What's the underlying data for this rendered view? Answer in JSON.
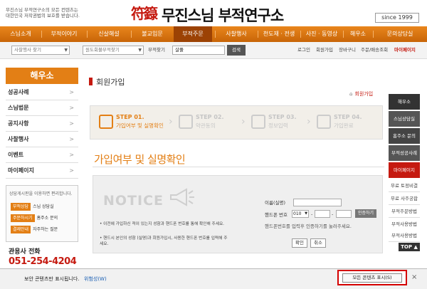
{
  "header": {
    "notice_line1": "무진스님 부적연구소의 모든 컨텐츠는",
    "notice_line2": "대한민국 저작권법의 보호를 받습니다.",
    "logo_seal": "符籙",
    "logo_text": "무진스님 부적연구소",
    "since": "since 1999"
  },
  "nav": [
    {
      "label": "스님소개"
    },
    {
      "label": "부적이야기"
    },
    {
      "label": "신살해설"
    },
    {
      "label": "불교입문"
    },
    {
      "label": "부적주문"
    },
    {
      "label": "사찰행사"
    },
    {
      "label": "천도재 · 전생"
    },
    {
      "label": "사진 · 동영상"
    },
    {
      "label": "해우소"
    },
    {
      "label": "문의상담실"
    }
  ],
  "searchbar": {
    "select1": "사찰행사 찾기",
    "select2": "원도회불부적찾기",
    "label": "부적찾기",
    "value": "살풀",
    "button": "검색",
    "links": [
      "로그인",
      "회원가입",
      "장바구니",
      "주문/배송조회"
    ],
    "mypage": "마이페이지"
  },
  "left_sidebar": {
    "title": "해우소",
    "items": [
      "성공사례",
      "스님법문",
      "공지사항",
      "사찰행사",
      "이벤트",
      "마이페이지"
    ],
    "box_caption": "상담게시판을 이용하면 편리합니다.",
    "box_rows": [
      {
        "tag": "부적상담",
        "text": "스님 상담실"
      },
      {
        "tag": "주문하시기",
        "text": "홈주소 문의"
      },
      {
        "tag": "결제안내",
        "text": "자주하는 질문"
      }
    ],
    "call_label": "관용사 전화",
    "call_number": "051-254-4204"
  },
  "main": {
    "page_title": "회원가입",
    "breadcrumb": "회원가입",
    "steps": [
      {
        "num": "STEP 01.",
        "label": "가입여부 및 실명확인"
      },
      {
        "num": "STEP 02.",
        "label": "약관동의"
      },
      {
        "num": "STEP 03.",
        "label": "정보입력"
      },
      {
        "num": "STEP 04.",
        "label": "가입완료"
      }
    ],
    "section_title": "가입여부 및 실명확인",
    "notice_word": "NOTICE",
    "info1": "이전에 가입하신 적이 있는지 성함과 핸드폰 번호를 통해 확인해 주세요.",
    "info2": "핸드시 본인의 성함 (실명)과 회원가입시, 사용한 핸드폰 번호를 입력해 주세요.",
    "form": {
      "name_label": "이름(실명)",
      "phone_label": "핸드폰 번호",
      "phone_prefix": "010",
      "auth_button": "인증하기",
      "hint": "핸드폰번호를 입력후 인증하기를 눌러주세요.",
      "confirm_button": "확인",
      "cancel_button": "취소"
    }
  },
  "right_sidebar": {
    "items": [
      {
        "label": "해우소",
        "color": "#333333"
      },
      {
        "label": "스님상담실",
        "color": "#555555"
      },
      {
        "label": "홈주소 문의",
        "color": "#444444"
      },
      {
        "label": "부적성공사례",
        "color": "#555555"
      },
      {
        "label": "마이페이지",
        "color": "#c51a10"
      }
    ],
    "links": [
      "무료 토정비결",
      "무료 사주궁합",
      "부적주문방법",
      "부적사용방법",
      "부적사용방법"
    ],
    "top_label": "TOP ▲"
  },
  "infobar": {
    "message": "보안 콘텐츠만 표시됩니다.",
    "risk_link": "위험성(W)",
    "show_all_button": "모든 콘텐츠 표시(S)",
    "close": "×"
  },
  "colors": {
    "accent": "#e37f15",
    "brand_red": "#c51a10",
    "highlight": "#d40000"
  }
}
